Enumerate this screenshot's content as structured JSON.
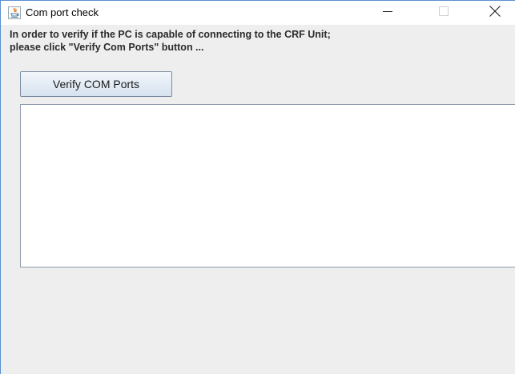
{
  "window": {
    "title": "Com port check",
    "icon": "java-icon",
    "controls": {
      "minimize_icon": "minimize-icon",
      "maximize_icon": "maximize-icon",
      "close_icon": "close-icon"
    }
  },
  "main": {
    "instruction_line1": "In order to verify if the PC is capable of connecting to the CRF Unit;",
    "instruction_line2": "please click \"Verify Com Ports\" button ...",
    "verify_button_label": "Verify COM Ports",
    "output_text": ""
  },
  "colors": {
    "window_border": "#5a8fd0",
    "content_background": "#eeeeee",
    "button_border": "#7a8ba0"
  }
}
